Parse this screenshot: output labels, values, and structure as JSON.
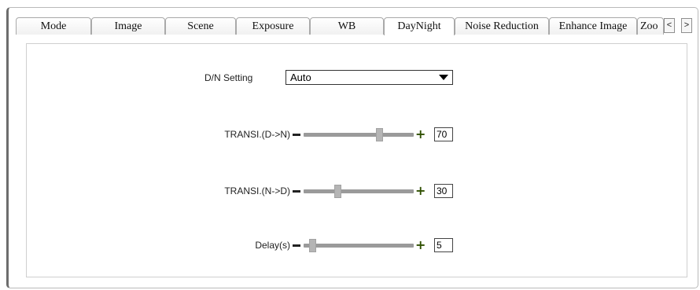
{
  "tabs": [
    {
      "label": "Mode",
      "active": false
    },
    {
      "label": "Image",
      "active": false
    },
    {
      "label": "Scene",
      "active": false
    },
    {
      "label": "Exposure",
      "active": false
    },
    {
      "label": "WB",
      "active": false
    },
    {
      "label": "DayNight",
      "active": true
    },
    {
      "label": "Noise Reduction",
      "active": false
    },
    {
      "label": "Enhance Image",
      "active": false
    },
    {
      "label": "Zoo",
      "active": false
    }
  ],
  "scroll": {
    "left": "<",
    "right": ">"
  },
  "dn_setting": {
    "label": "D/N Setting",
    "value": "Auto"
  },
  "sliders": [
    {
      "label": "TRANSI.(D->N)",
      "value": "70",
      "level": 0.7
    },
    {
      "label": "TRANSI.(N->D)",
      "value": "30",
      "level": 0.3
    },
    {
      "label": "Delay(s)",
      "value": "5",
      "level": 0.05
    }
  ]
}
